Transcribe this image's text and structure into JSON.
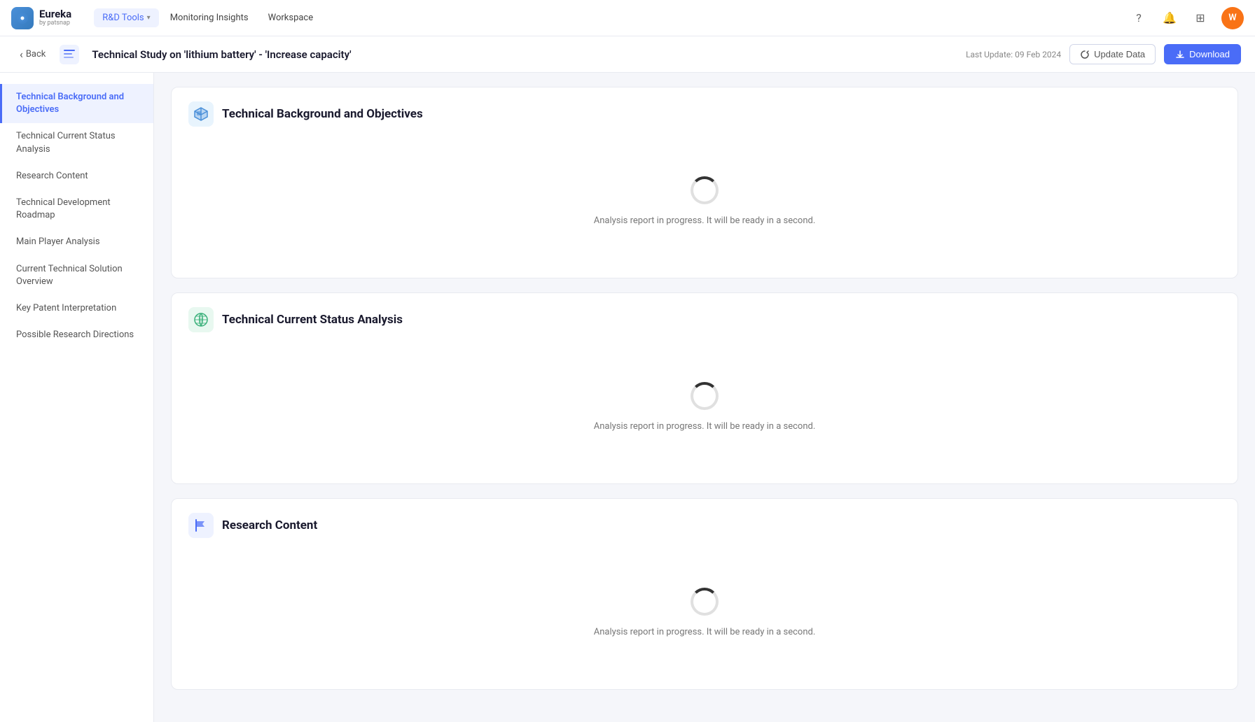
{
  "app": {
    "brand_name": "Eureka",
    "brand_sub": "by patsnap",
    "user_initial": "W"
  },
  "nav": {
    "items": [
      {
        "id": "rd-tools",
        "label": "R&D Tools",
        "has_dropdown": true,
        "active": true
      },
      {
        "id": "monitoring",
        "label": "Monitoring Insights",
        "has_dropdown": false,
        "active": false
      },
      {
        "id": "workspace",
        "label": "Workspace",
        "has_dropdown": false,
        "active": false
      }
    ]
  },
  "page_header": {
    "back_label": "Back",
    "title": "Technical Study on 'lithium battery' - 'Increase capacity'",
    "last_update_label": "Last Update: 09 Feb 2024",
    "update_data_label": "Update Data",
    "download_label": "Download"
  },
  "sidebar": {
    "items": [
      {
        "id": "tech-background",
        "label": "Technical Background and Objectives",
        "active": true
      },
      {
        "id": "current-status",
        "label": "Technical Current Status Analysis",
        "active": false
      },
      {
        "id": "research-content",
        "label": "Research Content",
        "active": false
      },
      {
        "id": "dev-roadmap",
        "label": "Technical Development Roadmap",
        "active": false
      },
      {
        "id": "player-analysis",
        "label": "Main Player Analysis",
        "active": false
      },
      {
        "id": "solution-overview",
        "label": "Current Technical Solution Overview",
        "active": false
      },
      {
        "id": "patent-interpretation",
        "label": "Key Patent Interpretation",
        "active": false
      },
      {
        "id": "research-directions",
        "label": "Possible Research Directions",
        "active": false
      }
    ]
  },
  "sections": [
    {
      "id": "tech-background",
      "title": "Technical Background and Objectives",
      "icon_type": "cube",
      "loading_text": "Analysis report in progress. It will be ready in a second."
    },
    {
      "id": "current-status",
      "title": "Technical Current Status Analysis",
      "icon_type": "globe",
      "loading_text": "Analysis report in progress. It will be ready in a second."
    },
    {
      "id": "research-content",
      "title": "Research Content",
      "icon_type": "flag",
      "loading_text": "Analysis report in progress. It will be ready in a second."
    }
  ]
}
